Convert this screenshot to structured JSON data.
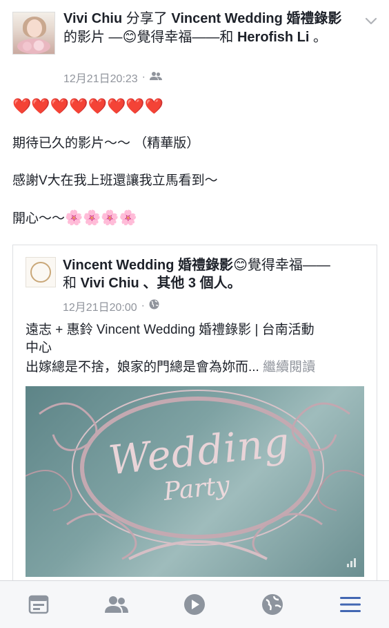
{
  "post": {
    "author": "Vivi Chiu",
    "shared_text": " 分享了 ",
    "page_name": "Vincent Wedding 婚禮錄影",
    "video_text": "的影片 —",
    "feeling_emoji": "😊",
    "feeling_text": "覺得幸福——和 ",
    "tagged": "Herofish Li",
    "end_mark": " 。",
    "timestamp": "12月21日20:23",
    "dot": "·",
    "hearts": "❤️❤️❤️❤️❤️❤️❤️❤️",
    "line1": "期待已久的影片～～ （精華版）",
    "line2": "感謝V大在我上班還讓我立馬看到～",
    "line3_text": "開心～～",
    "line3_emoji": "🌸🌸🌸🌸"
  },
  "shared_card": {
    "page_name": "Vincent Wedding 婚禮錄影",
    "feeling_emoji": "😊",
    "feeling_text": "覺得幸福——",
    "with_text": "和 ",
    "tagged": "Vivi Chiu",
    "others": " 、其他 3 個人。",
    "timestamp": "12月21日20:00",
    "dot": "·",
    "title_line1": "遠志 + 惠鈴 Vincent Wedding 婚禮錄影 | 台南活動",
    "title_line2": "中心",
    "description": "出嫁總是不捨，娘家的門總是會為妳而... ",
    "more_label": "繼續閱讀",
    "image_title": "Wedding",
    "image_subtitle": "Party"
  },
  "navbar": {
    "items": [
      "news-feed",
      "friends",
      "watch",
      "notifications",
      "menu"
    ],
    "accent": "#4267b2",
    "icon_color": "#8d949e"
  }
}
